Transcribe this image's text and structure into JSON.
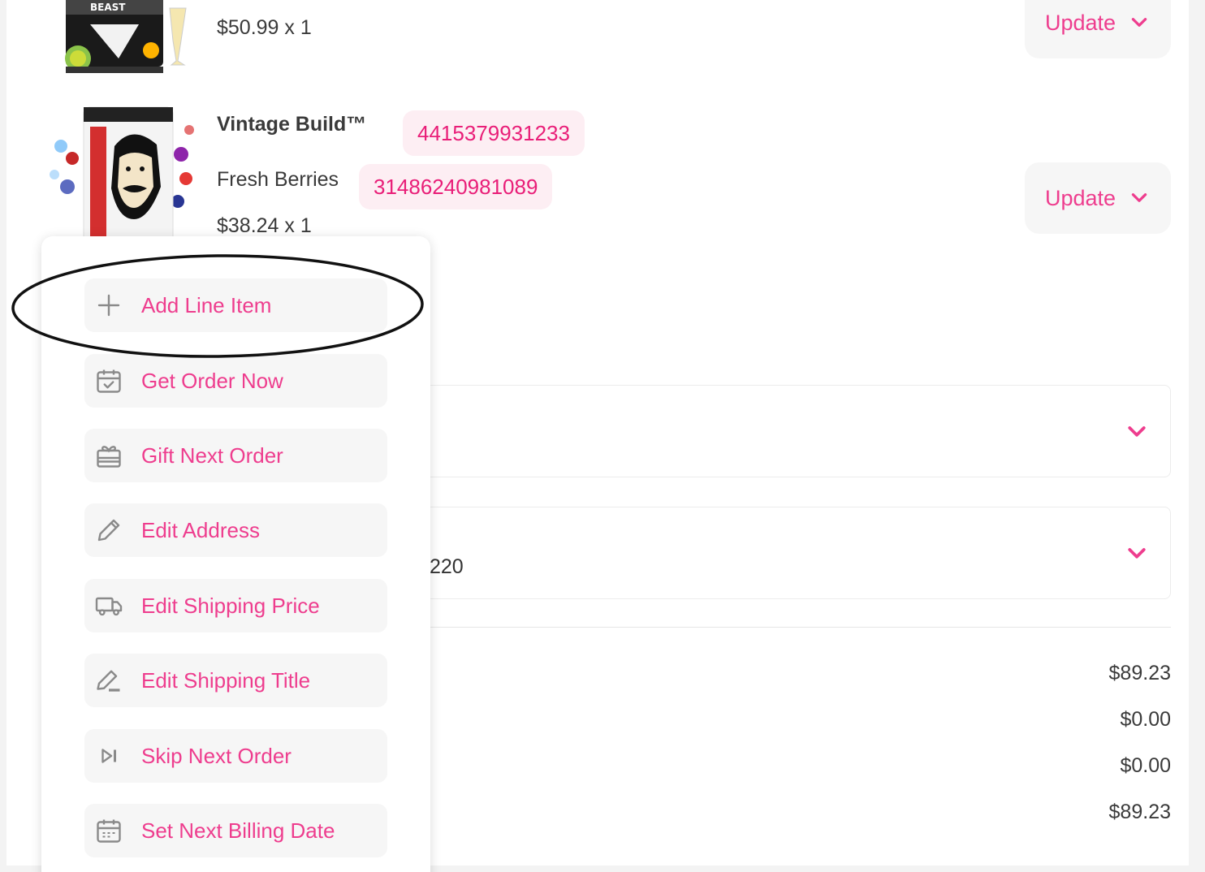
{
  "products": [
    {
      "name": "",
      "variant": "",
      "price_qty": "$50.99 x 1",
      "sku_primary": "",
      "sku_variant": "",
      "action_label": "Update",
      "image_icon": "product-tub-image"
    },
    {
      "name": "Vintage Build™",
      "variant": "Fresh Berries",
      "price_qty": "$38.24 x 1",
      "sku_primary": "4415379931233",
      "sku_variant": "31486240981089",
      "action_label": "Update",
      "image_icon": "product-tub-image"
    }
  ],
  "address": {
    "partial_text": "220"
  },
  "totals": [
    "$89.23",
    "$0.00",
    "$0.00",
    "$89.23"
  ],
  "menu": {
    "items": [
      {
        "label": "Add Line Item",
        "icon": "plus-icon"
      },
      {
        "label": "Get Order Now",
        "icon": "calendar-check-icon"
      },
      {
        "label": "Gift Next Order",
        "icon": "gift-icon"
      },
      {
        "label": "Edit Address",
        "icon": "pencil-icon"
      },
      {
        "label": "Edit Shipping Price",
        "icon": "truck-icon"
      },
      {
        "label": "Edit Shipping Title",
        "icon": "pencil-line-icon"
      },
      {
        "label": "Skip Next Order",
        "icon": "skip-next-icon"
      },
      {
        "label": "Set Next Billing Date",
        "icon": "calendar-icon"
      }
    ]
  },
  "colors": {
    "accent": "#ee3d8e",
    "chip_bg": "#fdeef3",
    "button_bg": "#f6f6f6",
    "text": "#3a3a3a",
    "annotation": "#111111"
  }
}
